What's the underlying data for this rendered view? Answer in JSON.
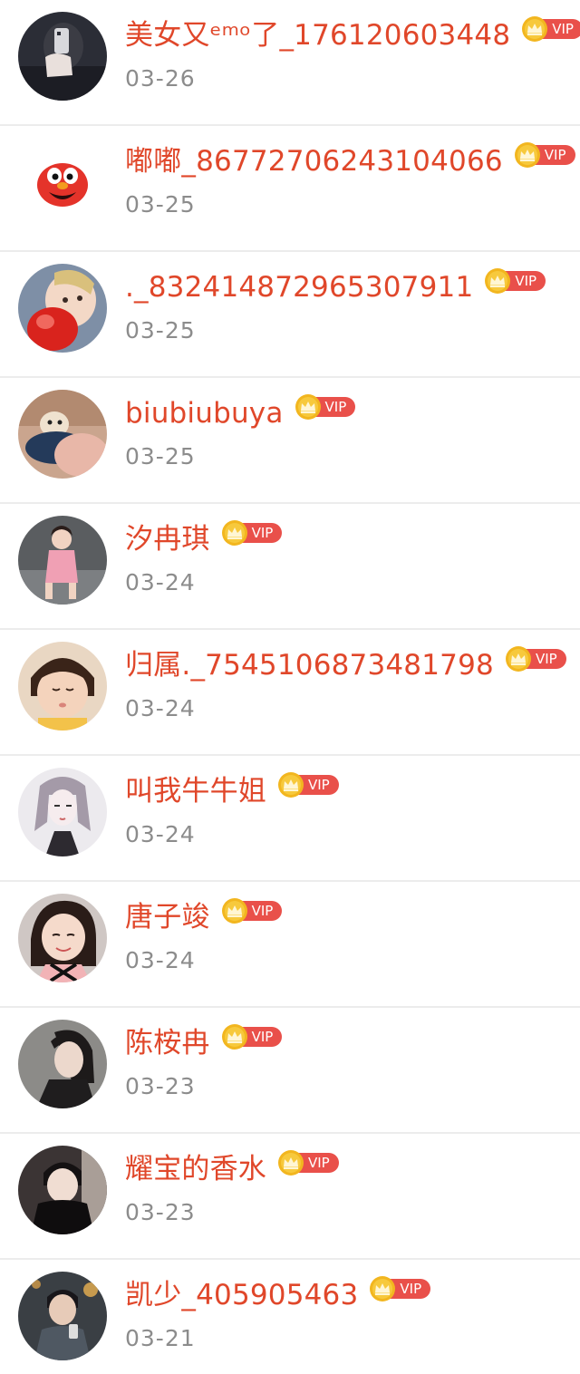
{
  "users": [
    {
      "name": "美女又ᵉᵐᵒ了_176120603448",
      "date": "03-26",
      "vip": "VIP"
    },
    {
      "name": "嘟嘟_86772706243104066",
      "date": "03-25",
      "vip": "VIP"
    },
    {
      "name": "._832414872965307911",
      "date": "03-25",
      "vip": "VIP"
    },
    {
      "name": "biubiubuya",
      "date": "03-25",
      "vip": "VIP"
    },
    {
      "name": "汐冉琪",
      "date": "03-24",
      "vip": "VIP"
    },
    {
      "name": "归属._7545106873481798",
      "date": "03-24",
      "vip": "VIP"
    },
    {
      "name": "叫我牛牛姐",
      "date": "03-24",
      "vip": "VIP"
    },
    {
      "name": "唐子竣",
      "date": "03-24",
      "vip": "VIP"
    },
    {
      "name": "陈桉冉",
      "date": "03-23",
      "vip": "VIP"
    },
    {
      "name": "耀宝的香水",
      "date": "03-23",
      "vip": "VIP"
    },
    {
      "name": "凯少_405905463",
      "date": "03-21",
      "vip": "VIP"
    }
  ],
  "colors": {
    "name": "#e0472a",
    "date": "#8c8c8c",
    "vip_badge": "#e9504a",
    "crown_coin": "#f2b61f",
    "divider": "#ececec"
  },
  "icons": {
    "vip_crown": "crown-icon"
  }
}
